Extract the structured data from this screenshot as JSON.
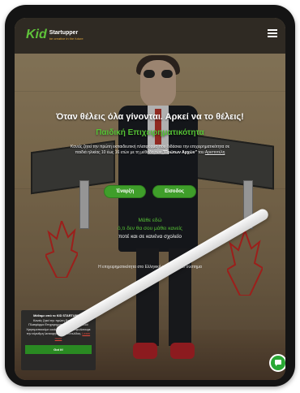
{
  "header": {
    "logo_kid": "Kid",
    "logo_startupper": "Startupper",
    "logo_tagline": "be creative in the future"
  },
  "hero": {
    "title": "Όταν θέλεις όλα γίνονται. Αρκεί να το θέλεις!",
    "subtitle": "Παιδική Επιχειρηματικότητα",
    "description_1": "Κανείς ζητεί την πρώτη εκπαιδευτική πλατφόρμα που διδάσκει την",
    "description_2": "επιχειρηματικότητα σε παιδιά ηλικίας 10 έως 16 ετών με τη μέθοδο των",
    "description_bold": "\"Πρώτων Αρχών\"",
    "description_3": "του",
    "description_link": "Αριστοτέλη",
    "btn_login": "Είσοδος",
    "btn_start": "Έναρξη"
  },
  "learn": {
    "line1": "Μάθε εδώ",
    "line2": "ό,τι δεν θα σου μάθει κανείς",
    "line3": "ποτέ και σε κανένα σχολείο"
  },
  "bottom": {
    "line": "Η επιχειρηματικότητα στο Ελληνικό εκπαιδευτικό σύστημα"
  },
  "cookie": {
    "title": "Μάθαμε από το KID STARTUPPER",
    "text": "Κανείς ζητεί την πρώτη Εκπαιδευτική Πλατφόρμα Επιχειρηματικότητας για παιδιά! Χρησιμοποιούμε cookies για να διασφαλίσουμε την εύρυθμη λειτουργία της ιστοσελίδας.",
    "link": "Learn more",
    "button": "Got it!"
  },
  "colors": {
    "accent_green": "#3f9e2a",
    "text_green": "#55c235",
    "header_bg": "#2f2a23"
  }
}
